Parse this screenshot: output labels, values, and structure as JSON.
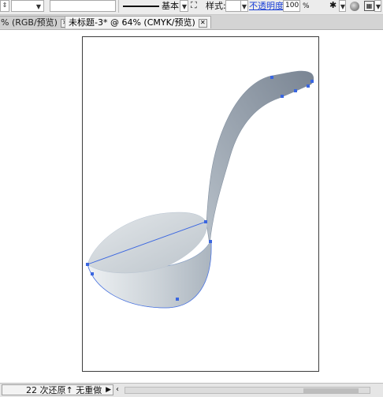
{
  "toolbar": {
    "stroke_style_label": "基本",
    "style_label": "样式:",
    "opacity_label": "不透明度:",
    "opacity_value": "100",
    "percent_symbol": "%"
  },
  "tabs": [
    {
      "label": "% (RGB/预览)",
      "active": false
    },
    {
      "label": "未标题-3* @ 64% (CMYK/预览)",
      "active": true
    }
  ],
  "status": {
    "undo_text": "22 次还原↑ 无重做"
  },
  "colors": {
    "anchor": "#3a66e0",
    "handle_fill_light": "#d6dde3",
    "handle_fill_dark": "#7f8a96",
    "bowl_fill": "#a7b2bd"
  },
  "icons": [
    "stepper-icon",
    "chevron-down-icon",
    "transform-icon",
    "brush-icon",
    "globe-icon",
    "grid-icon",
    "close-icon",
    "play-icon"
  ]
}
